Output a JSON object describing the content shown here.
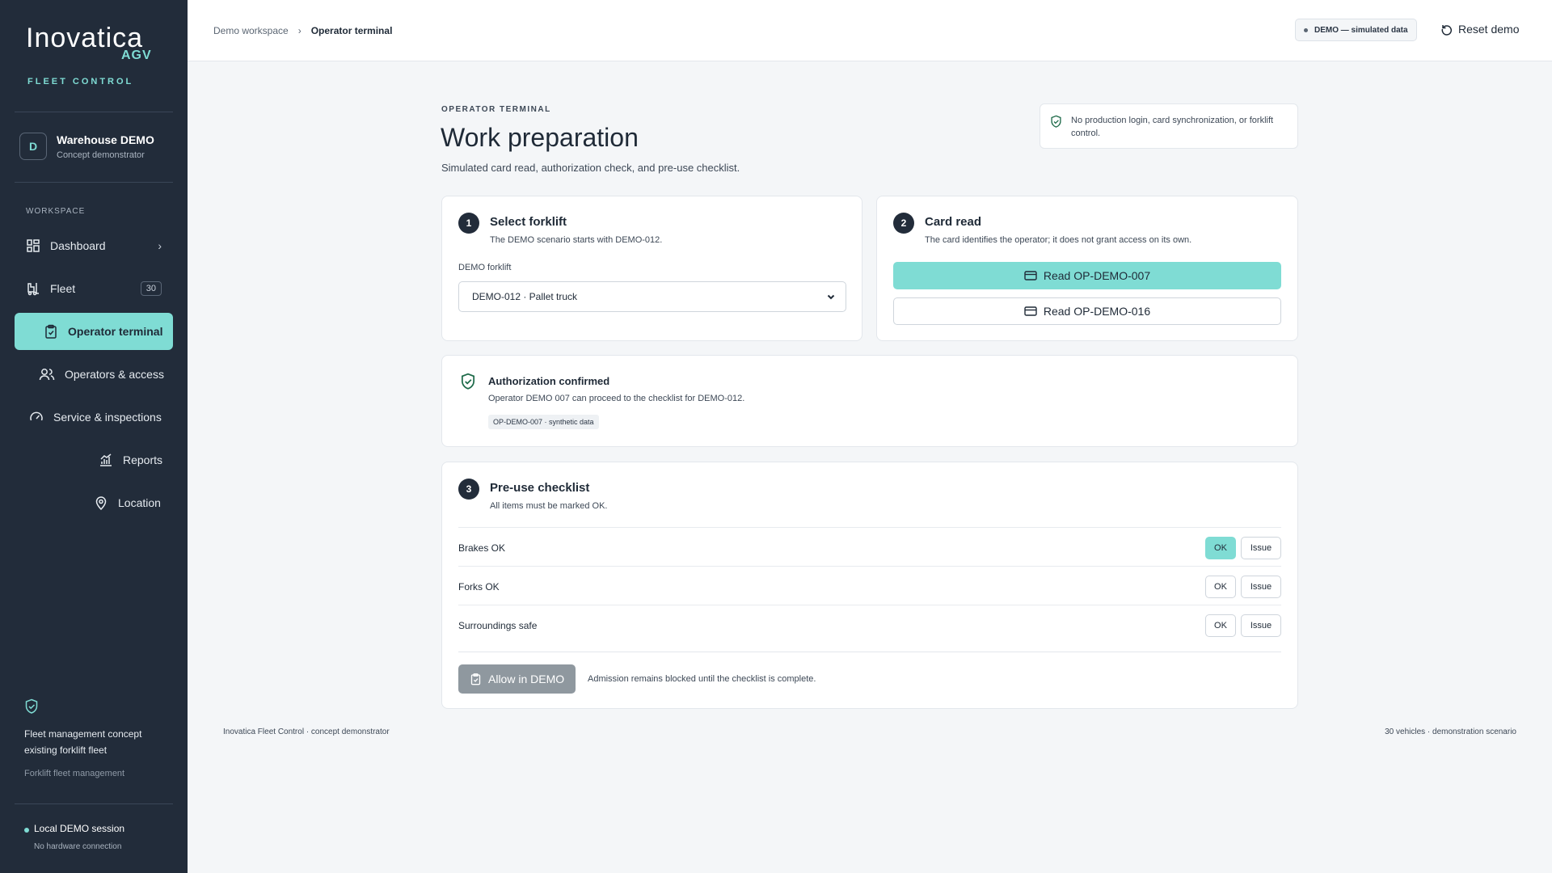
{
  "brand": {
    "name": "Inovatica",
    "tag": "AGV",
    "subtitle": "FLEET CONTROL"
  },
  "workspace": {
    "initial": "D",
    "name": "Warehouse DEMO",
    "description": "Concept demonstrator"
  },
  "sidebar": {
    "section_label": "WORKSPACE",
    "items": [
      {
        "label": "Dashboard",
        "icon": "grid-icon"
      },
      {
        "label": "Fleet",
        "icon": "forklift-icon",
        "badge": "30"
      },
      {
        "label": "Operator terminal",
        "icon": "clipboard-icon",
        "active": true
      },
      {
        "label": "Operators & access",
        "icon": "users-icon"
      },
      {
        "label": "Service & inspections",
        "icon": "gauge-icon"
      },
      {
        "label": "Reports",
        "icon": "chart-icon"
      },
      {
        "label": "Location",
        "icon": "map-pin-icon"
      }
    ],
    "concept_text": "Fleet management concept existing forklift fleet",
    "mgmt_text": "Forklift fleet management",
    "session_title": "Local DEMO session",
    "session_sub": "No hardware connection"
  },
  "topbar": {
    "breadcrumb_root": "Demo workspace",
    "breadcrumb_current": "Operator terminal",
    "demo_pill": "DEMO — simulated data",
    "reset_label": "Reset demo"
  },
  "page": {
    "eyebrow": "OPERATOR TERMINAL",
    "title": "Work preparation",
    "subtitle": "Simulated card read, authorization check, and pre-use checklist.",
    "notice": "No production login, card synchronization, or forklift control."
  },
  "step1": {
    "num": "1",
    "title": "Select forklift",
    "sub": "The DEMO scenario starts with DEMO-012.",
    "field_label": "DEMO forklift",
    "selected": "DEMO-012 · Pallet truck"
  },
  "step2": {
    "num": "2",
    "title": "Card read",
    "sub": "The card identifies the operator; it does not grant access on its own.",
    "btn_primary": "Read OP-DEMO-007",
    "btn_secondary": "Read OP-DEMO-016"
  },
  "auth": {
    "title": "Authorization confirmed",
    "desc": "Operator DEMO 007 can proceed to the checklist for DEMO-012.",
    "tag": "OP-DEMO-007 · synthetic data"
  },
  "step3": {
    "num": "3",
    "title": "Pre-use checklist",
    "sub": "All items must be marked OK.",
    "ok_label": "OK",
    "issue_label": "Issue",
    "items": [
      {
        "label": "Brakes OK",
        "ok": true
      },
      {
        "label": "Forks OK",
        "ok": false
      },
      {
        "label": "Surroundings safe",
        "ok": false
      }
    ],
    "allow_label": "Allow in DEMO",
    "allow_note": "Admission remains blocked until the checklist is complete."
  },
  "footer": {
    "left": "Inovatica Fleet Control · concept demonstrator",
    "right": "30 vehicles · demonstration scenario"
  },
  "colors": {
    "sidebar_bg": "#222c3a",
    "accent": "#7fdcd4",
    "disabled": "#8f989f"
  }
}
